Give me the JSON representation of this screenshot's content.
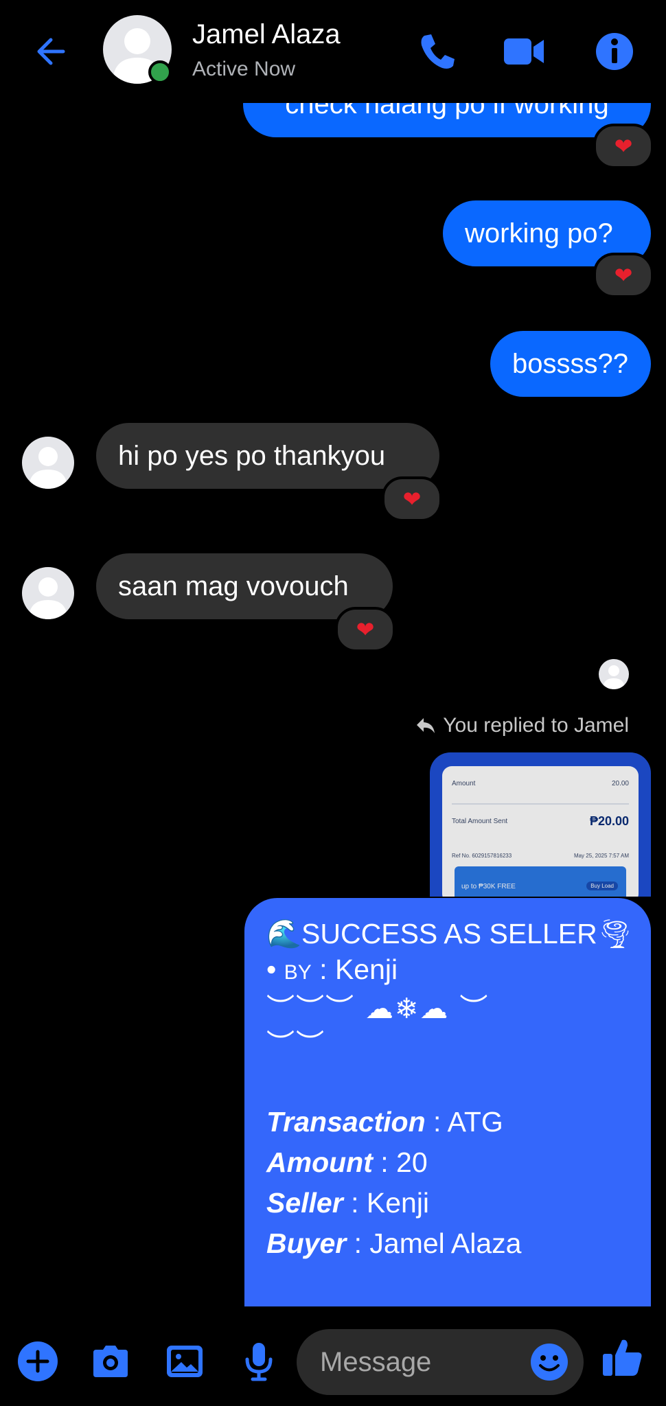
{
  "header": {
    "name": "Jamel Alaza",
    "status": "Active Now"
  },
  "messages": {
    "m1": "check nalang po if working",
    "m2": "working po?",
    "m3": "bossss??",
    "m4": "hi po yes po thankyou",
    "m5": "saan mag vovouch"
  },
  "reaction": "❤",
  "reply": {
    "label": "You replied to Jamel"
  },
  "receipt": {
    "amount_label": "Amount",
    "amount_value": "20.00",
    "total_label": "Total Amount Sent",
    "total_value": "₱20.00",
    "ref_label": "Ref No. 6029157816233",
    "date": "May 25, 2025 7:57 AM",
    "banner_text": "up to ₱30K FREE",
    "banner_button": "Buy Load"
  },
  "card": {
    "title": "🌊SUCCESS AS SELLER🌪",
    "by_prefix": "• ",
    "by_label": "BY",
    "by_value": " : Kenji",
    "deco1": "︶︶︶ ☁❄☁ ︶",
    "deco2": "︶︶",
    "rows": [
      {
        "label": "Transaction",
        "value": " : ATG"
      },
      {
        "label": "Amount",
        "value": " : 20"
      },
      {
        "label": "Seller",
        "value": " : Kenji"
      },
      {
        "label": "Buyer",
        "value": " : Jamel Alaza"
      }
    ]
  },
  "composer": {
    "placeholder": "Message"
  },
  "colors": {
    "accent": "#0a68ff",
    "card": "#3467fb",
    "incoming": "#303030",
    "online": "#31a24c"
  }
}
